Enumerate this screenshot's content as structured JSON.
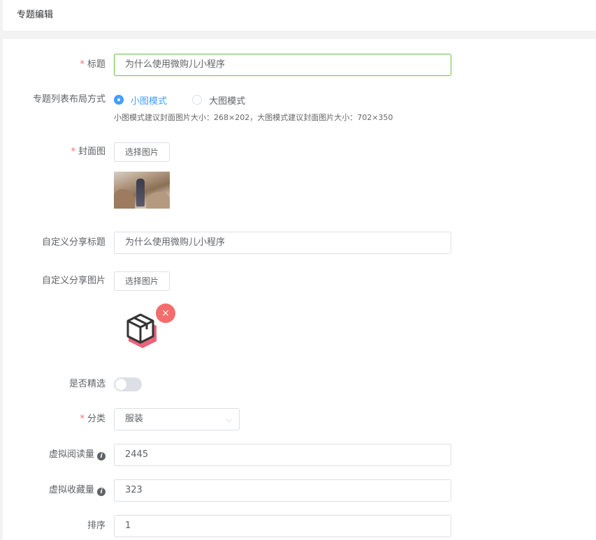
{
  "header": {
    "title": "专题编辑"
  },
  "form": {
    "title": {
      "label": "标题",
      "value": "为什么使用微购儿小程序"
    },
    "layout": {
      "label": "专题列表布局方式",
      "options": [
        "小图模式",
        "大图模式"
      ],
      "selected": "小图模式",
      "hint": "小图模式建议封面图片大小：268×202，大图模式建议封面图片大小：702×350"
    },
    "cover": {
      "label": "封面图",
      "button": "选择图片"
    },
    "share_title": {
      "label": "自定义分享标题",
      "value": "为什么使用微购儿小程序"
    },
    "share_image": {
      "label": "自定义分享图片",
      "button": "选择图片",
      "close": "×"
    },
    "featured": {
      "label": "是否精选",
      "on": false
    },
    "category": {
      "label": "分类",
      "value": "服装",
      "arrow": "⌵"
    },
    "virtual_reads": {
      "label": "虚拟阅读量",
      "value": "2445",
      "info": "i"
    },
    "virtual_favs": {
      "label": "虚拟收藏量",
      "value": "323",
      "info": "i"
    },
    "sort": {
      "label": "排序",
      "value": "1"
    }
  },
  "colors": {
    "primary": "#409eff",
    "required": "#f56c6c",
    "focus_border": "#67c23a",
    "close": "#f56c6c"
  },
  "icons": {
    "share_placeholder": "box-icon",
    "close": "close-icon",
    "info": "info-icon",
    "select_arrow": "chevron-down-icon"
  }
}
